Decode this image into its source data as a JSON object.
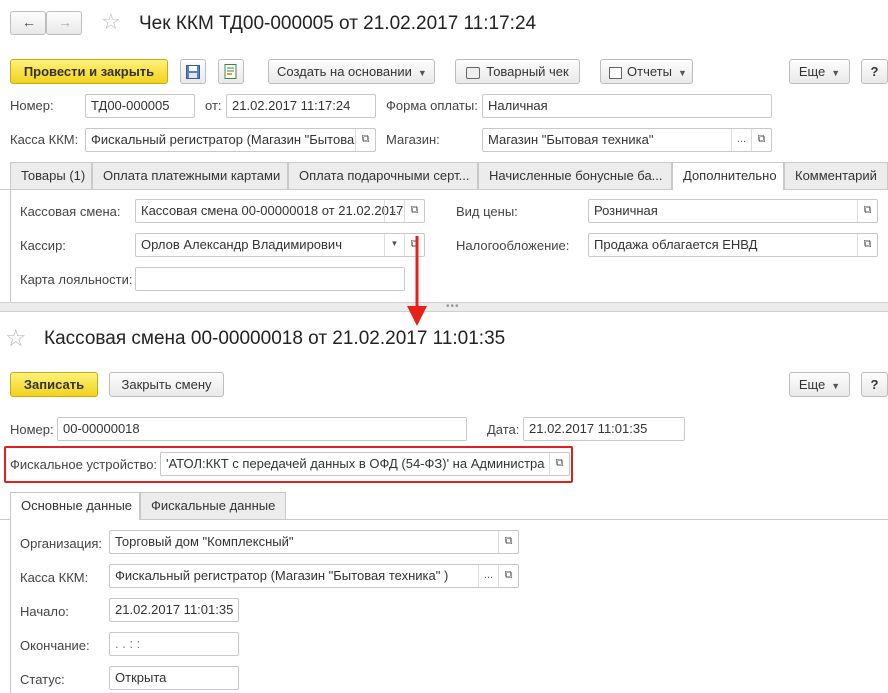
{
  "top": {
    "title": "Чек ККМ ТД00-000005 от 21.02.2017 11:17:24",
    "buttons": {
      "post_close": "Провести и закрыть",
      "create_based": "Создать на основании",
      "product_receipt": "Товарный чек",
      "reports": "Отчеты",
      "more": "Еще",
      "help": "?"
    },
    "number_label": "Номер:",
    "number_value": "ТД00-000005",
    "from_label": "от:",
    "from_value": "21.02.2017 11:17:24",
    "payment_label": "Форма оплаты:",
    "payment_value": "Наличная",
    "register_label": "Касса ККМ:",
    "register_value": "Фискальный регистратор (Магазин \"Бытова",
    "store_label": "Магазин:",
    "store_value": "Магазин \"Бытовая техника\"",
    "tabs": [
      "Товары (1)",
      "Оплата платежными картами",
      "Оплата подарочными серт...",
      "Начисленные бонусные ба...",
      "Дополнительно",
      "Комментарий"
    ],
    "shift_label": "Кассовая смена:",
    "shift_value": "Кассовая смена 00-00000018 от 21.02.2017",
    "cashier_label": "Кассир:",
    "cashier_value": "Орлов Александр Владимирович",
    "loyalty_label": "Карта лояльности:",
    "loyalty_value": "",
    "price_type_label": "Вид цены:",
    "price_type_value": "Розничная",
    "tax_label": "Налогообложение:",
    "tax_value": "Продажа облагается ЕНВД"
  },
  "bottom": {
    "title": "Кассовая смена 00-00000018 от 21.02.2017 11:01:35",
    "buttons": {
      "save": "Записать",
      "close_shift": "Закрыть смену",
      "more": "Еще",
      "help": "?"
    },
    "number_label": "Номер:",
    "number_value": "00-00000018",
    "date_label": "Дата:",
    "date_value": "21.02.2017 11:01:35",
    "fiscal_label": "Фискальное устройство:",
    "fiscal_value": "'АТОЛ:ККТ с передачей данных в ОФД (54-ФЗ)' на Администра",
    "tabs": [
      "Основные данные",
      "Фискальные данные"
    ],
    "org_label": "Организация:",
    "org_value": "Торговый дом \"Комплексный\"",
    "register_label": "Касса ККМ:",
    "register_value": "Фискальный регистратор (Магазин \"Бытовая техника\" )",
    "start_label": "Начало:",
    "start_value": "21.02.2017 11:01:35",
    "end_label": "Окончание:",
    "end_value": ".  .       :  :",
    "status_label": "Статус:",
    "status_value": "Открыта"
  },
  "colors": {
    "accent_yellow": "#f1d21b",
    "highlight_red": "#e02020",
    "arrow_red": "#e8201c"
  },
  "icons": [
    "back-arrow-icon",
    "forward-arrow-icon",
    "star-icon",
    "save-disk-icon",
    "document-icon",
    "print-icon",
    "reports-icon",
    "open-link-icon"
  ]
}
